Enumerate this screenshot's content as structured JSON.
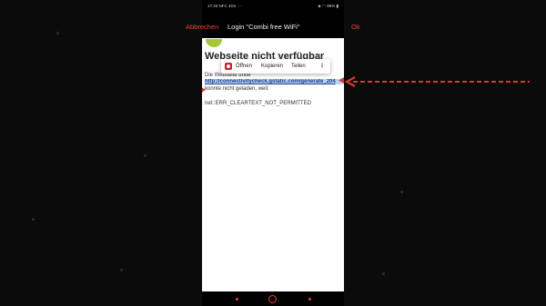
{
  "status_bar": {
    "time": "17:33",
    "left_indicators": "NFC 4Gs",
    "battery": "86%"
  },
  "title_bar": {
    "cancel_label": "Abbrechen",
    "title": "Login \"Combi free WiFi\"",
    "ok_label": "Ok"
  },
  "page": {
    "error_title": "Webseite nicht verfügbar",
    "description_start": "Die Webseite unter",
    "url": "http://connectivitycheck.gstatic.com/generate_204",
    "description_end": "konnte nicht geladen, weil:",
    "error_code": "net::ERR_CLEARTEXT_NOT_PERMITTED"
  },
  "selection_popup": {
    "open_label": "Öffnen",
    "copy_label": "Kopieren",
    "share_label": "Teilen",
    "more_label": "⋮"
  },
  "colors": {
    "accent": "#e5443a",
    "selection": "#b7d4f5",
    "arrow": "#d23b30"
  }
}
